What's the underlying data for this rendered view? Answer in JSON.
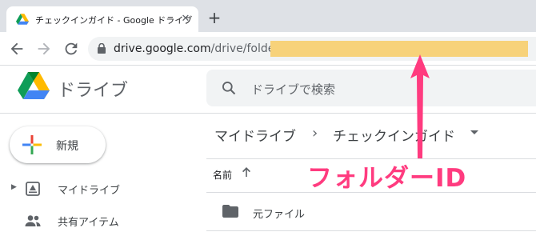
{
  "browser": {
    "tab_title": "チェックインガイド - Google ドライブ",
    "tab_close": "✕",
    "new_tab": "+",
    "url_host": "drive.google.com",
    "url_path": "/drive/folders/"
  },
  "drive": {
    "app_name": "ドライブ",
    "search_placeholder": "ドライブで検索"
  },
  "sidebar": {
    "new_label": "新規",
    "items": [
      {
        "label": "マイドライブ"
      },
      {
        "label": "共有アイテム"
      }
    ]
  },
  "main": {
    "breadcrumb_root": "マイドライブ",
    "breadcrumb_sep": "›",
    "breadcrumb_current": "チェックインガイド",
    "column_name": "名前",
    "rows": [
      {
        "name": "元ファイル"
      }
    ]
  },
  "annotation": {
    "label": "フォルダーID",
    "color": "#ff3b7f",
    "highlight_color": "#f7d27a"
  },
  "icons": [
    "google-drive-icon",
    "close-icon",
    "plus-icon",
    "back-arrow-icon",
    "forward-arrow-icon",
    "reload-icon",
    "lock-icon",
    "search-icon",
    "my-drive-icon",
    "shared-people-icon",
    "folder-icon",
    "sort-up-arrow-icon"
  ]
}
